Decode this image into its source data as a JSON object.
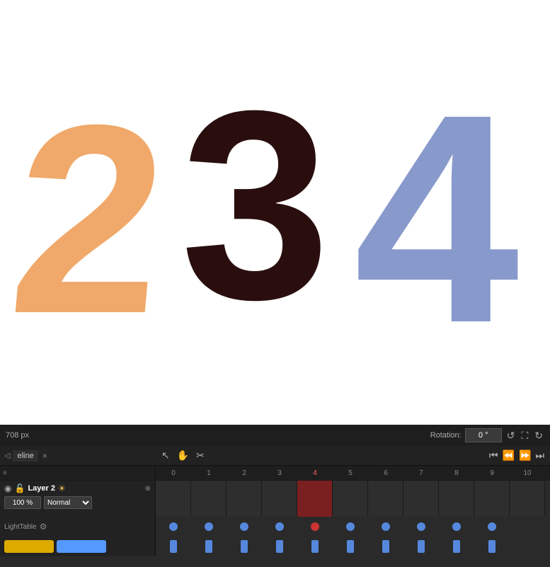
{
  "canvas": {
    "numbers": [
      "2",
      "3",
      "4"
    ],
    "colors": [
      "#f0a96a",
      "#2a0e0e",
      "#8899cc"
    ]
  },
  "topBar": {
    "px_label": "708 px",
    "rotation_label": "Rotation:",
    "rotation_value": "0 °"
  },
  "timeline": {
    "tab_label": "eline",
    "layer_name": "Layer 2",
    "zoom_value": "100 %",
    "blend_mode": "Normal",
    "lighttable_label": "LightTable",
    "ruler_ticks": [
      "0",
      "1",
      "2",
      "3",
      "4",
      "5",
      "6",
      "7",
      "8",
      "9",
      "10"
    ]
  },
  "icons": {
    "arrow": "▶",
    "cursor": "↖",
    "hand": "✋",
    "scissors": "✂",
    "close": "×",
    "sun": "☀",
    "settings": "⚙",
    "prev_frame": "⏮",
    "prev_key": "⏪",
    "next_key": "⏩",
    "next_frame": "⏭",
    "expand": "⛶",
    "refresh": "↺",
    "layers": "≡"
  }
}
